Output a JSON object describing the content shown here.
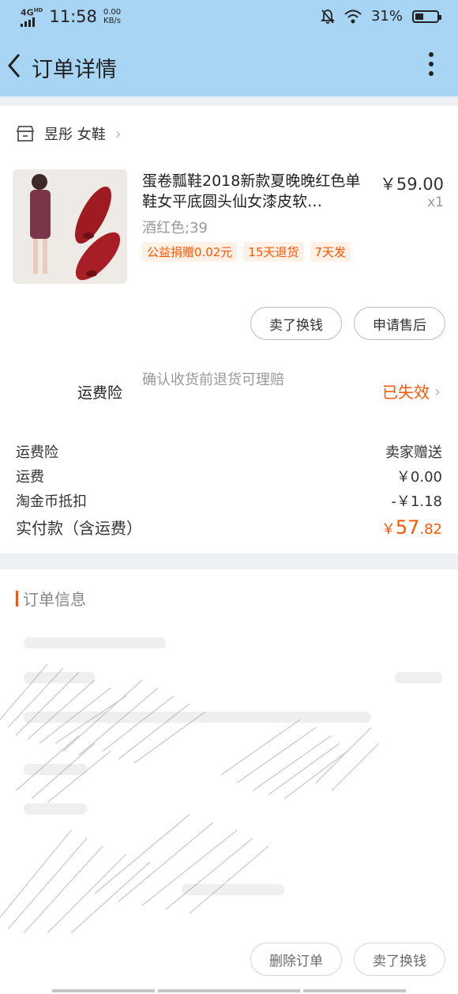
{
  "status_bar": {
    "network": "4G",
    "network_sup": "HD",
    "time": "11:58",
    "speed_value": "0.00",
    "speed_unit": "KB/s",
    "battery": "31%"
  },
  "header": {
    "title": "订单详情"
  },
  "shop": {
    "name": "昱彤 女鞋"
  },
  "product": {
    "title": "蛋卷瓢鞋2018新款夏晚晚红色单鞋女平底圆头仙女漆皮软…",
    "price": "￥59.00",
    "quantity": "x1",
    "spec": "酒红色;39",
    "tags": [
      "公益捐赠0.02元",
      "15天退货",
      "7天发"
    ]
  },
  "product_actions": {
    "sell_label": "卖了换钱",
    "after_sale_label": "申请售后"
  },
  "insurance": {
    "label": "运费险",
    "description": "确认收货前退货可理赔",
    "status": "已失效"
  },
  "summary": {
    "rows": [
      {
        "label": "运费险",
        "value": "卖家赠送"
      },
      {
        "label": "运费",
        "value": "￥0.00"
      },
      {
        "label": "淘金币抵扣",
        "value": "-￥1.18"
      }
    ],
    "total_label": "实付款（含运费）",
    "total_currency": "￥",
    "total_int": "57",
    "total_dec": ".82"
  },
  "order_info": {
    "title": "订单信息"
  },
  "bottom_actions": {
    "delete_label": "删除订单",
    "sell_label": "卖了换钱"
  },
  "colors": {
    "header_bg": "#a7d5f3",
    "accent": "#ff5500",
    "tag_bg": "#fff1e6",
    "separator": "#eef1f4"
  },
  "icons": {
    "back": "chevron-left-icon",
    "more": "more-vertical-icon",
    "shop": "store-icon",
    "arrow": "chevron-right-icon"
  }
}
